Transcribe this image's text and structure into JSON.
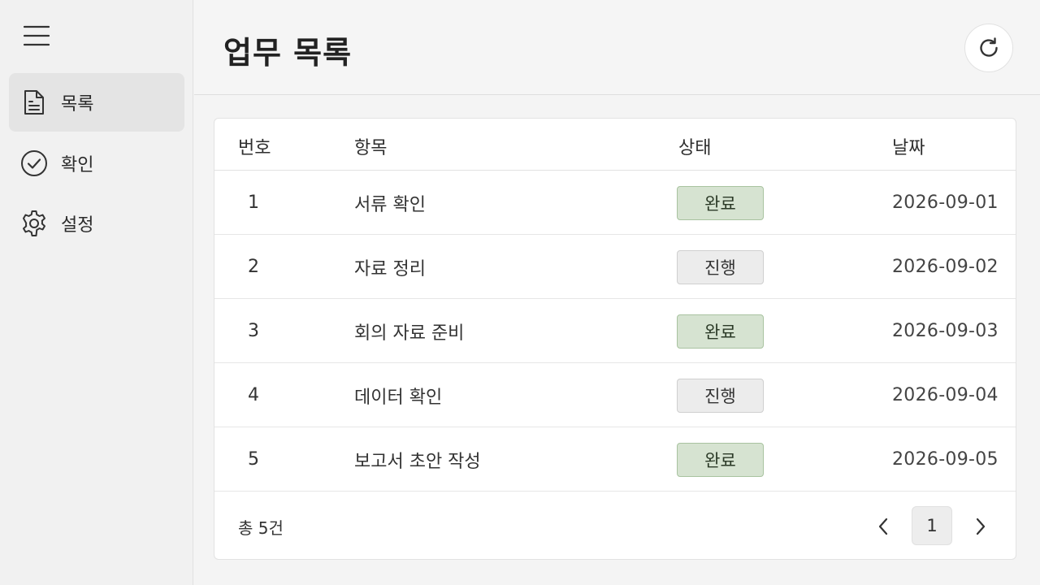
{
  "sidebar": {
    "menu_icon": "hamburger-menu-icon",
    "items": [
      {
        "label": "목록",
        "icon": "document-icon",
        "active": true
      },
      {
        "label": "확인",
        "icon": "check-circle-icon",
        "active": false
      },
      {
        "label": "설정",
        "icon": "gear-icon",
        "active": false
      }
    ]
  },
  "header": {
    "title": "업무 목록",
    "refresh_icon": "refresh-icon"
  },
  "table": {
    "columns": [
      "번호",
      "항목",
      "상태",
      "날짜"
    ],
    "rows": [
      {
        "num": "1",
        "item": "서류 확인",
        "status": "완료",
        "status_type": "done",
        "date": "2026-09-01"
      },
      {
        "num": "2",
        "item": "자료 정리",
        "status": "진행",
        "status_type": "progress",
        "date": "2026-09-02"
      },
      {
        "num": "3",
        "item": "회의 자료 준비",
        "status": "완료",
        "status_type": "done",
        "date": "2026-09-03"
      },
      {
        "num": "4",
        "item": "데이터 확인",
        "status": "진행",
        "status_type": "progress",
        "date": "2026-09-04"
      },
      {
        "num": "5",
        "item": "보고서 초안 작성",
        "status": "완료",
        "status_type": "done",
        "date": "2026-09-05"
      }
    ]
  },
  "footer": {
    "total": "총 5건",
    "current_page": "1"
  },
  "colors": {
    "done_bg": "#d6e3d1",
    "progress_bg": "#ececec",
    "active_nav_bg": "#e4e4e4"
  }
}
